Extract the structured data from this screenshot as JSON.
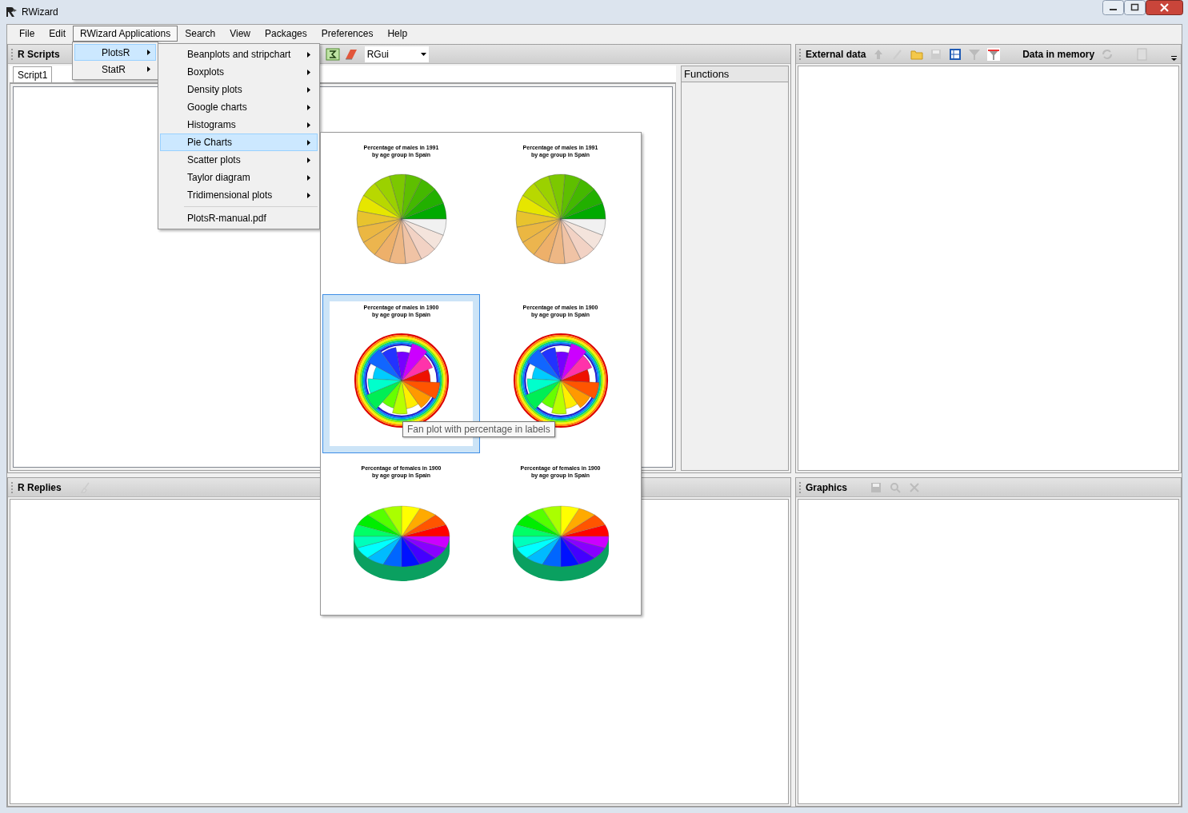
{
  "window": {
    "title": "RWizard"
  },
  "menu_bar": [
    {
      "label": "File",
      "selected": false
    },
    {
      "label": "Edit",
      "selected": false
    },
    {
      "label": "RWizard Applications",
      "selected": true
    },
    {
      "label": "Search",
      "selected": false
    },
    {
      "label": "View",
      "selected": false
    },
    {
      "label": "Packages",
      "selected": false
    },
    {
      "label": "Preferences",
      "selected": false
    },
    {
      "label": "Help",
      "selected": false
    }
  ],
  "applications_menu": [
    {
      "label": "PlotsR",
      "selected": true
    },
    {
      "label": "StatR",
      "selected": false
    }
  ],
  "plotsr_menu": {
    "items": [
      {
        "label": "Beanplots and stripchart",
        "selected": false
      },
      {
        "label": "Boxplots",
        "selected": false
      },
      {
        "label": "Density plots",
        "selected": false
      },
      {
        "label": "Google charts",
        "selected": false
      },
      {
        "label": "Histograms",
        "selected": false
      },
      {
        "label": "Pie Charts",
        "selected": true
      },
      {
        "label": "Scatter plots",
        "selected": false
      },
      {
        "label": "Taylor diagram",
        "selected": false
      },
      {
        "label": "Tridimensional plots",
        "selected": false
      }
    ],
    "manual": "PlotsR-manual.pdf"
  },
  "gallery": {
    "thumbnails": [
      {
        "title": "Percentage of males in 1991",
        "subtitle": "by age group in Spain",
        "kind": "pie",
        "selected": false
      },
      {
        "title": "Percentage of males in 1991",
        "subtitle": "by age group in Spain",
        "kind": "pie",
        "selected": false
      },
      {
        "title": "Percentage of males in 1900",
        "subtitle": "by age group in Spain",
        "kind": "fan",
        "selected": true
      },
      {
        "title": "Percentage of males in 1900",
        "subtitle": "by age group in Spain",
        "kind": "fan",
        "selected": false
      },
      {
        "title": "Percentage of females in 1900",
        "subtitle": "by age group in Spain",
        "kind": "pie3d",
        "selected": false
      },
      {
        "title": "Percentage of females in 1900",
        "subtitle": "by age group in Spain",
        "kind": "pie3d",
        "selected": false
      }
    ],
    "tooltip": "Fan plot with percentage in labels"
  },
  "scripts_panel": {
    "title": "R Scripts",
    "engine": "RGui",
    "tabs": [
      {
        "label": "Script1",
        "selected": true
      }
    ]
  },
  "functions_panel": {
    "title": "Functions"
  },
  "external_panel": {
    "title": "External data",
    "memory_title": "Data in memory"
  },
  "replies_panel": {
    "title": "R Replies"
  },
  "graphics_panel": {
    "title": "Graphics"
  }
}
